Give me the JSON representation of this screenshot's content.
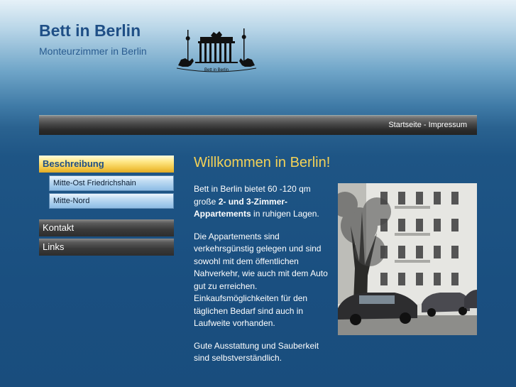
{
  "header": {
    "title": "Bett in Berlin",
    "subtitle": "Monteurzimmer in Berlin",
    "logo_text": "Bett in Berlin"
  },
  "topnav": {
    "home": "Startseite",
    "separator": " - ",
    "imprint": "Impressum"
  },
  "sidebar": {
    "items": [
      {
        "label": "Beschreibung",
        "active": true
      },
      {
        "label": "Kontakt"
      },
      {
        "label": "Links"
      }
    ],
    "subitems": [
      {
        "label": "Mitte-Ost Friedrichshain"
      },
      {
        "label": "Mitte-Nord"
      }
    ]
  },
  "main": {
    "heading": "Willkommen in Berlin!",
    "p1_a": "Bett in Berlin bietet 60 -120 qm große ",
    "p1_b": "2- und 3-Zimmer-Appartements",
    "p1_c": " in ruhigen Lagen.",
    "p2": "Die Appartements sind verkehrsgünstig gelegen und sind sowohl mit dem öffentlichen Nahverkehr, wie auch mit dem Auto gut zu erreichen. Einkaufsmöglichkeiten für den täglichen Bedarf sind auch in Laufweite vorhanden.",
    "p3": "Gute Ausstattung und Sauberkeit sind selbstverständlich."
  },
  "colors": {
    "accent": "#f4d257",
    "title": "#1f4f86",
    "background": "#1a4f80"
  }
}
